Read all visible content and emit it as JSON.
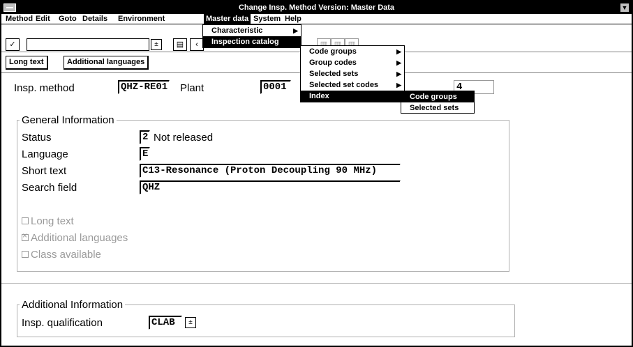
{
  "window": {
    "title": "Change Insp. Method Version: Master Data"
  },
  "menubar": {
    "items": [
      "Method",
      "Edit",
      "Goto",
      "Details",
      "Environment",
      "Master data",
      "System",
      "Help"
    ]
  },
  "toolbar": {
    "command_value": ""
  },
  "appbar": {
    "long_text": "Long text",
    "additional_languages": "Additional languages"
  },
  "header": {
    "insp_method_label": "Insp. method",
    "insp_method_value": "QHZ-RE01",
    "plant_label": "Plant",
    "plant_value": "0001",
    "version_value": "4"
  },
  "general": {
    "title": "General Information",
    "status_label": "Status",
    "status_value": "2",
    "status_text": "Not released",
    "language_label": "Language",
    "language_value": "E",
    "short_text_label": "Short text",
    "short_text_value": "C13-Resonance (Proton Decoupling 90 MHz)",
    "search_label": "Search field",
    "search_value": "QHZ",
    "long_text_check": "Long text",
    "additional_languages_check": "Additional languages",
    "class_available_check": "Class available"
  },
  "additional": {
    "title": "Additional Information",
    "qualification_label": "Insp. qualification",
    "qualification_value": "CLAB"
  },
  "master_data_menu": {
    "items": [
      "Characteristic",
      "Inspection catalog"
    ]
  },
  "catalog_menu": {
    "items": [
      "Code groups",
      "Group codes",
      "Selected sets",
      "Selected set codes",
      "Index"
    ]
  },
  "index_menu": {
    "items": [
      "Code groups",
      "Selected sets"
    ]
  }
}
